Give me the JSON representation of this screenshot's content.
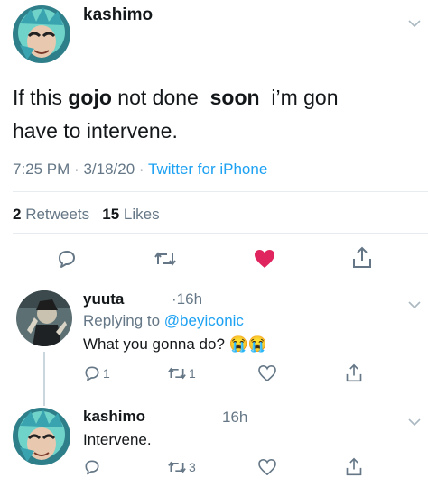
{
  "main_tweet": {
    "author": "kashimo",
    "text": {
      "part1": "If this",
      "word_gojo": "gojo",
      "part2": "not done",
      "word_soon": "soon",
      "part3": "i’m gon",
      "line2": "have to intervene."
    },
    "time": "7:25 PM",
    "date": "3/18/20",
    "sep": "·",
    "source": "Twitter for iPhone",
    "retweets_count": "2",
    "retweets_label": "Retweets",
    "likes_count": "15",
    "likes_label": "Likes",
    "actions": {
      "like_color": "#e0245e"
    }
  },
  "replies": [
    {
      "author": "yuuta",
      "time": "·16h",
      "replying_prefix": "Replying to",
      "replying_to": "@beyiconic",
      "text": "What you gonna do? 😭😭",
      "reply_count": "1",
      "retweet_count": "1"
    },
    {
      "author": "kashimo",
      "time": "16h",
      "text": "Intervene.",
      "retweet_count": "3"
    }
  ],
  "colors": {
    "link": "#1da1f2",
    "muted": "#657786",
    "like": "#e0245e"
  }
}
